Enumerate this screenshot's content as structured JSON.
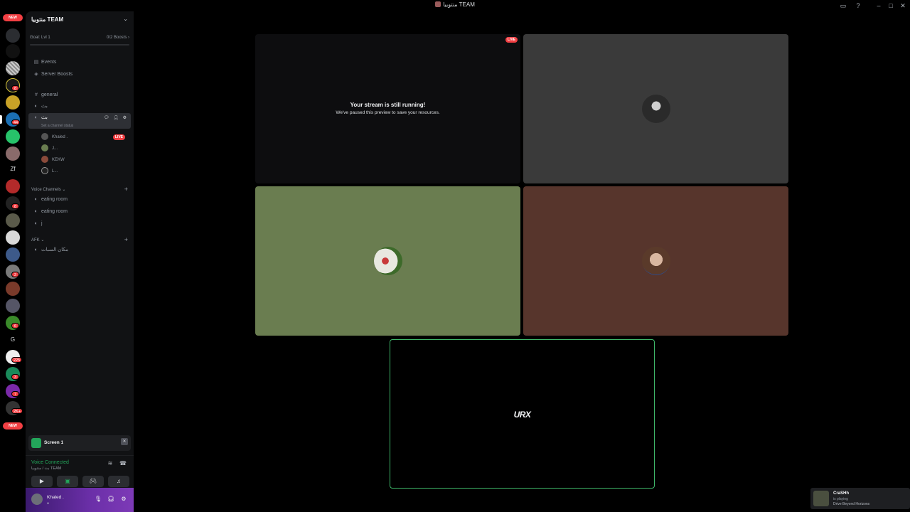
{
  "window": {
    "title": "منتوبيا TEAM"
  },
  "rail": {
    "new_top": "NEW",
    "new_bottom": "NEW",
    "badges": [
      "8",
      "44",
      "8",
      "2",
      "6",
      "225",
      "3",
      "7",
      "2K+"
    ],
    "letters": [
      "Zf",
      "G"
    ]
  },
  "server": {
    "name": "منتوبيا TEAM",
    "goal_label": "Goal: Lvl 1",
    "boosts": "0/2 Boosts"
  },
  "sidebar": {
    "events": "Events",
    "server_boosts": "Server Boosts",
    "general": "general",
    "ch_bat": "بث",
    "ch_bat_selected": "بث",
    "channel_status": "Set a channel status",
    "voice_users": [
      "Khaled .",
      "J...",
      "KEKW",
      "L..."
    ],
    "live": "LIVE",
    "cat_voice": "Voice Channels",
    "eating1": "eating room",
    "eating2": "eating room",
    "ch_j": "j",
    "cat_afk": "AFK",
    "afk_channel": "مكان السبات"
  },
  "panels": {
    "screen_label": "Screen 1",
    "voice_connected": "Voice Connected",
    "voice_sub": "بث / منتوبيا TEAM",
    "user_name": "Khaled .",
    "user_status": "●"
  },
  "stage": {
    "live": "LIVE",
    "paused_title": "Your stream is still running!",
    "paused_sub": "We've paused this preview to save your resources.",
    "screen_logo": "URX"
  },
  "toast": {
    "name": "CraSHh",
    "playing": "is playing",
    "game": "Drive Beyond Horizons"
  },
  "colors": {
    "accent_green": "#23a55a",
    "danger": "#f23f43",
    "tile_olive": "#6a7d50",
    "tile_brown": "#57352c",
    "tile_gray": "#3a3a3a"
  }
}
